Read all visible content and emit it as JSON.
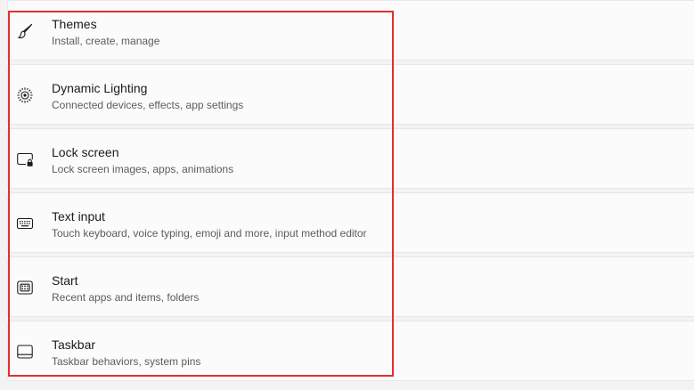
{
  "settings": {
    "items": [
      {
        "title": "Themes",
        "subtitle": "Install, create, manage",
        "icon": "brush-icon"
      },
      {
        "title": "Dynamic Lighting",
        "subtitle": "Connected devices, effects, app settings",
        "icon": "lighting-icon"
      },
      {
        "title": "Lock screen",
        "subtitle": "Lock screen images, apps, animations",
        "icon": "lock-screen-icon"
      },
      {
        "title": "Text input",
        "subtitle": "Touch keyboard, voice typing, emoji and more, input method editor",
        "icon": "keyboard-icon"
      },
      {
        "title": "Start",
        "subtitle": "Recent apps and items, folders",
        "icon": "start-icon"
      },
      {
        "title": "Taskbar",
        "subtitle": "Taskbar behaviors, system pins",
        "icon": "taskbar-icon"
      }
    ]
  },
  "colors": {
    "background": "#f3f3f3",
    "card": "#fbfbfb",
    "card_border": "#e7e7e7",
    "title_text": "#1b1b1b",
    "subtitle_text": "#5c5c5c",
    "highlight": "#e0312f"
  }
}
